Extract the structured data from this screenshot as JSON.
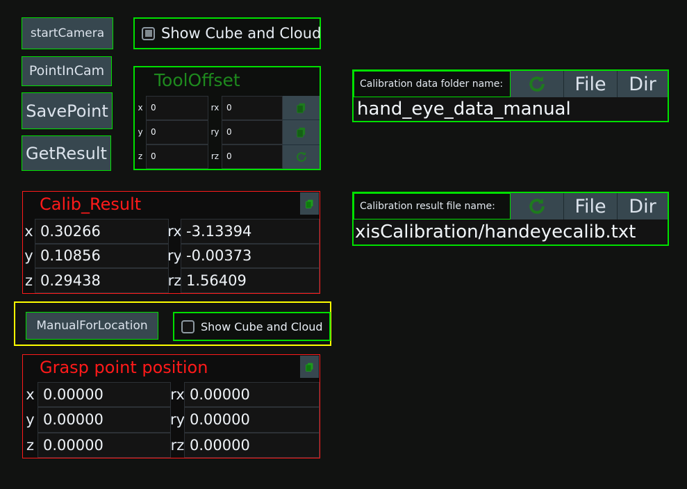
{
  "theme": {
    "background": "#111211",
    "accent_green": "#00e000",
    "accent_red": "#ff1a1a",
    "accent_yellow": "#ffff00",
    "button_face": "#37474f",
    "icon_green": "#1e7a1e",
    "text": "#dce3ec"
  },
  "left_buttons": [
    {
      "label": "startCamera"
    },
    {
      "label": "PointInCam"
    },
    {
      "label": "SavePoint"
    },
    {
      "label": "GetResult"
    }
  ],
  "show_cube_top": {
    "label": "Show Cube and Cloud",
    "checked": true
  },
  "tool_offset": {
    "title": "ToolOffset",
    "rows": [
      {
        "left_tag": "x",
        "left_value": "0",
        "right_tag": "rx",
        "right_value": "0",
        "icon": "copy-icon"
      },
      {
        "left_tag": "y",
        "left_value": "0",
        "right_tag": "ry",
        "right_value": "0",
        "icon": "copy-icon"
      },
      {
        "left_tag": "z",
        "left_value": "0",
        "right_tag": "rz",
        "right_value": "0",
        "icon": "refresh-icon"
      }
    ]
  },
  "calib_result": {
    "title": "Calib_Result",
    "copy_icon": "copy-icon",
    "rows": [
      {
        "left_tag": "x",
        "left_value": "0.30266",
        "right_tag": "rx",
        "right_value": "-3.13394"
      },
      {
        "left_tag": "y",
        "left_value": "0.10856",
        "right_tag": "ry",
        "right_value": "-0.00373"
      },
      {
        "left_tag": "z",
        "left_value": "0.29438",
        "right_tag": "rz",
        "right_value": "1.56409"
      }
    ]
  },
  "manual_section": {
    "button_label": "ManualForLocation",
    "checkbox": {
      "label": "Show Cube and Cloud",
      "checked": false
    }
  },
  "grasp_point": {
    "title": "Grasp point position",
    "copy_icon": "copy-icon",
    "rows": [
      {
        "left_tag": "x",
        "left_value": "0.00000",
        "right_tag": "rx",
        "right_value": "0.00000"
      },
      {
        "left_tag": "y",
        "left_value": "0.00000",
        "right_tag": "ry",
        "right_value": "0.00000"
      },
      {
        "left_tag": "z",
        "left_value": "0.00000",
        "right_tag": "rz",
        "right_value": "0.00000"
      }
    ]
  },
  "calib_folder": {
    "label": "Calibration data folder name:",
    "refresh_icon": "refresh-icon",
    "file_label": "File",
    "dir_label": "Dir",
    "value": "hand_eye_data_manual"
  },
  "calib_file": {
    "label": "Calibration result file name:",
    "refresh_icon": "refresh-icon",
    "file_label": "File",
    "dir_label": "Dir",
    "value": "xisCalibration/handeyecalib.txt"
  }
}
